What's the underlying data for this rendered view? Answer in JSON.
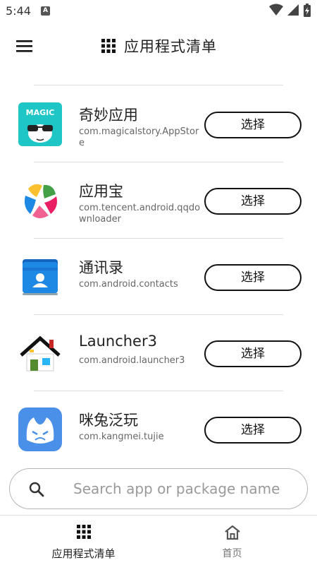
{
  "status_bar": {
    "time": "5:44",
    "notification_badge": "A"
  },
  "header": {
    "menu_icon": "hamburger-menu-icon",
    "title_icon": "grid-icon",
    "title": "应用程式清单"
  },
  "apps": [
    {
      "name": "奇妙应用",
      "package": "com.magicalstory.AppStore",
      "icon": "magic-app-icon",
      "select_label": "选择"
    },
    {
      "name": "应用宝",
      "package": "com.tencent.android.qqdownloader",
      "icon": "yingyongbao-icon",
      "select_label": "选择"
    },
    {
      "name": "通讯录",
      "package": "com.android.contacts",
      "icon": "contacts-icon",
      "select_label": "选择"
    },
    {
      "name": "Launcher3",
      "package": "com.android.launcher3",
      "icon": "launcher-house-icon",
      "select_label": "选择"
    },
    {
      "name": "咪兔泛玩",
      "package": "com.kangmei.tujie",
      "icon": "mitu-app-icon",
      "select_label": "选择"
    }
  ],
  "search": {
    "placeholder": "Search app or package name",
    "value": ""
  },
  "bottom_nav": [
    {
      "label": "应用程式清单",
      "icon": "grid-icon",
      "active": true
    },
    {
      "label": "首页",
      "icon": "home-icon",
      "active": false
    }
  ],
  "colors": {
    "accent": "#111111",
    "divider": "#dcdcdc",
    "magic_icon_bg": "#1ec6c6",
    "contacts_blue": "#1e88e5",
    "mitu_blue": "#4a8fe8"
  }
}
